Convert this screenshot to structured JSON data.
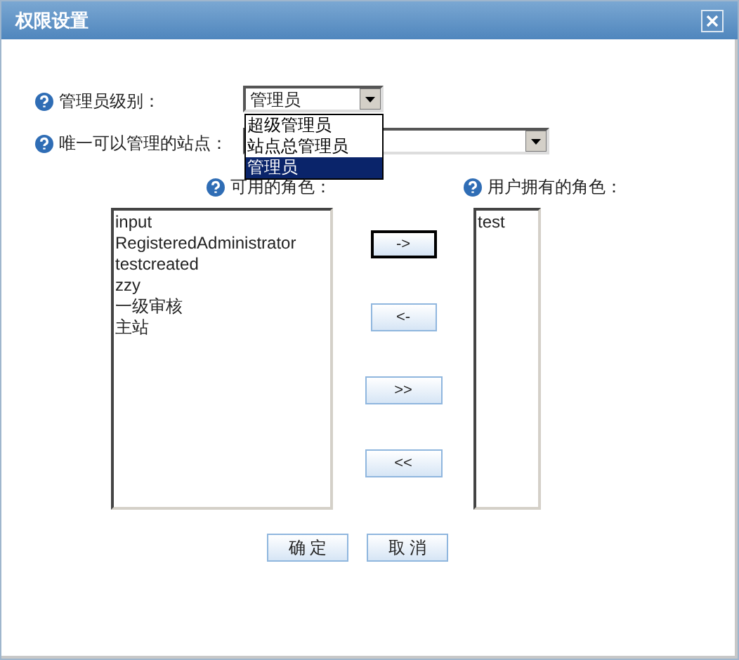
{
  "window": {
    "title": "权限设置"
  },
  "admin_level": {
    "label": "管理员级别：",
    "value": "管理员",
    "expanded": true,
    "options": [
      {
        "label": "超级管理员",
        "selected": false
      },
      {
        "label": "站点总管理员",
        "selected": false
      },
      {
        "label": "管理员",
        "selected": true
      }
    ]
  },
  "site": {
    "label": "唯一可以管理的站点："
  },
  "available_roles": {
    "label": "可用的角色：",
    "items": [
      "input",
      "RegisteredAdministrator",
      "testcreated",
      "zzy",
      "一级审核",
      "主站"
    ]
  },
  "move_buttons": [
    {
      "label": "->",
      "focused": true
    },
    {
      "label": "<-",
      "focused": false
    },
    {
      "label": ">>",
      "focused": false
    },
    {
      "label": "<<",
      "focused": false
    }
  ],
  "user_roles": {
    "label": "用户拥有的角色：",
    "items": [
      "test"
    ]
  },
  "buttons": [
    "确 定",
    "取 消"
  ]
}
